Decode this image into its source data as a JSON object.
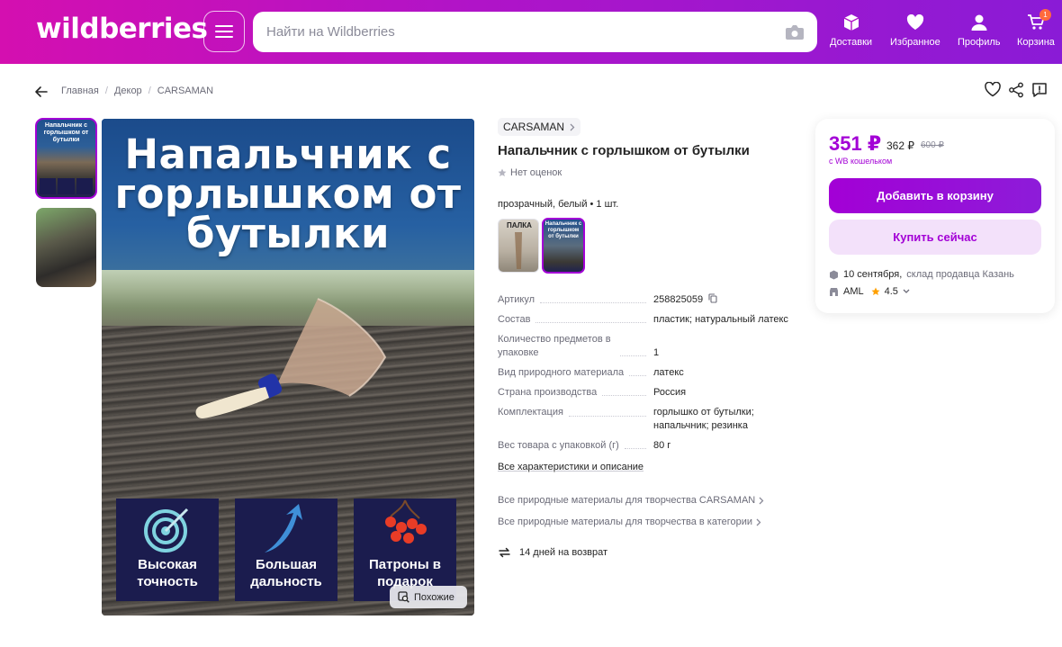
{
  "header": {
    "logo": "wildberries",
    "search_placeholder": "Найти на Wildberries",
    "nav": [
      {
        "label": "Доставки",
        "icon": "box-icon"
      },
      {
        "label": "Избранное",
        "icon": "heart-icon"
      },
      {
        "label": "Профиль",
        "icon": "user-icon"
      },
      {
        "label": "Корзина",
        "icon": "cart-icon",
        "badge": "1"
      }
    ],
    "brand_color": "#a300d6"
  },
  "breadcrumbs": [
    "Главная",
    "Декор",
    "CARSAMAN"
  ],
  "gallery": {
    "main_title": "Напальчник с горлышком от бутылки",
    "features": [
      "Высокая точность",
      "Большая дальность",
      "Патроны в подарок"
    ],
    "similar_label": "Похожие",
    "thumb_title": "Напальчник с горлышком от бутылки"
  },
  "product": {
    "brand": "CARSAMAN",
    "title": "Напальчник с горлышком от бутылки",
    "rating_text": "Нет оценок",
    "variant": "прозрачный, белый • 1 шт.",
    "swatch1_text": "ПАЛКА",
    "specs": [
      {
        "key": "Артикул",
        "value": "258825059"
      },
      {
        "key": "Состав",
        "value": "пластик; натуральный латекс"
      },
      {
        "key": "Количество предметов в упаковке",
        "value": "1"
      },
      {
        "key": "Вид природного материала",
        "value": "латекс"
      },
      {
        "key": "Страна производства",
        "value": "Россия"
      },
      {
        "key": "Комплектация",
        "value": "горлышко от бутылки; напальчник; резинка"
      },
      {
        "key": "Вес товара с упаковкой (г)",
        "value": "80 г"
      }
    ],
    "all_specs_link": "Все характеристики и описание",
    "more_links": [
      "Все природные материалы для творчества CARSAMAN",
      "Все природные материалы для творчества в категории"
    ],
    "returns": "14 дней на возврат"
  },
  "buy": {
    "price": "351 ₽",
    "price_alt": "362 ₽",
    "price_old": "600 ₽",
    "wallet_note": "с WB кошельком",
    "add_to_cart": "Добавить в корзину",
    "buy_now": "Купить сейчас",
    "delivery_date": "10 сентября,",
    "delivery_place": "склад продавца Казань",
    "seller": "AML",
    "seller_rating": "4.5"
  }
}
